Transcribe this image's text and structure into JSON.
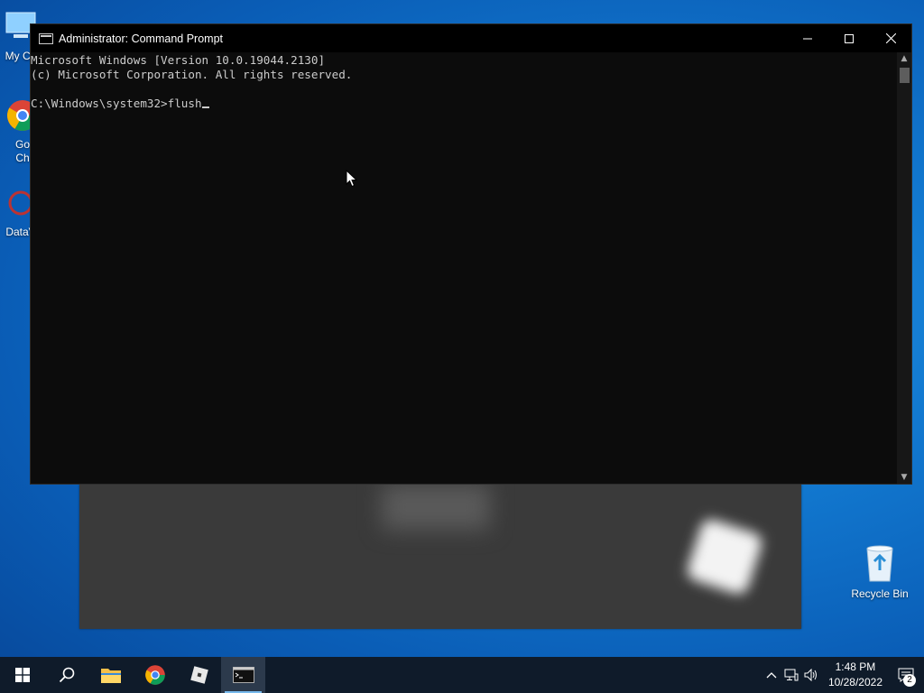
{
  "desktop": {
    "icons": [
      {
        "label": "My Co"
      },
      {
        "label": "Go\nCh"
      },
      {
        "label": "DataV"
      },
      {
        "label": "Recycle Bin"
      }
    ]
  },
  "cmd": {
    "title": "Administrator: Command Prompt",
    "lines": [
      "Microsoft Windows [Version 10.0.19044.2130]",
      "(c) Microsoft Corporation. All rights reserved.",
      "",
      "C:\\Windows\\system32>flush"
    ],
    "minimize_icon": "minimize-icon",
    "maximize_icon": "maximize-icon",
    "close_icon": "close-icon"
  },
  "taskbar": {
    "items": [
      "start",
      "search",
      "file-explorer",
      "chrome",
      "roblox",
      "command-prompt"
    ],
    "active": "command-prompt",
    "clock_time": "1:48 PM",
    "clock_date": "10/28/2022",
    "notification_count": "2"
  }
}
